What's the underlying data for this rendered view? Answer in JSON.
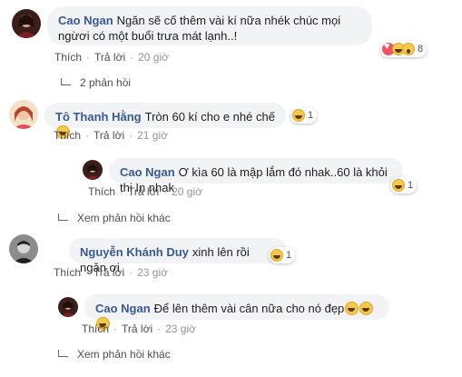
{
  "comments": [
    {
      "author": "Cao Ngan",
      "text": "Ngăn sẽ cố thêm vài kí nữa nhék chúc mọi ngừơi có một buổi trưa mát lạnh..!",
      "like": "Thích",
      "reply": "Trả lời",
      "time": "20 giờ",
      "reaction_count": "8",
      "reactions": [
        "love-icon",
        "haha-icon",
        "wow-icon"
      ],
      "replies_label": "2 phản hồi"
    },
    {
      "author": "Tô Thanh Hằng",
      "text": "Tròn 60 kí cho e nhé chế",
      "like": "Thích",
      "reply": "Trả lời",
      "time": "21 giờ",
      "reaction_count": "1",
      "reply_item": {
        "author": "Cao Ngan",
        "text": "Ơ kìa 60 là mập lắm đó nhak..60 là khỏi thi In nhak",
        "like": "Thích",
        "reply": "Trả lời",
        "time": "20 giờ",
        "reaction_count": "1"
      },
      "more_label": "Xem phản hồi khác"
    },
    {
      "author": "Nguyễn Khánh Duy",
      "text": "xinh lên rồi ngăn ơi",
      "like": "Thích",
      "reply": "Trả lời",
      "time": "23 giờ",
      "reaction_count": "1",
      "reply_item": {
        "author": "Cao Ngan",
        "text": "Để lên thêm vài cân nữa cho nó đẹp",
        "like": "Thích",
        "reply": "Trả lời",
        "time": "23 giờ"
      },
      "more_label": "Xem phản hồi khác"
    }
  ],
  "colors": {
    "author": "#385898",
    "bubble": "#f2f3f5",
    "meta": "#90949c"
  }
}
